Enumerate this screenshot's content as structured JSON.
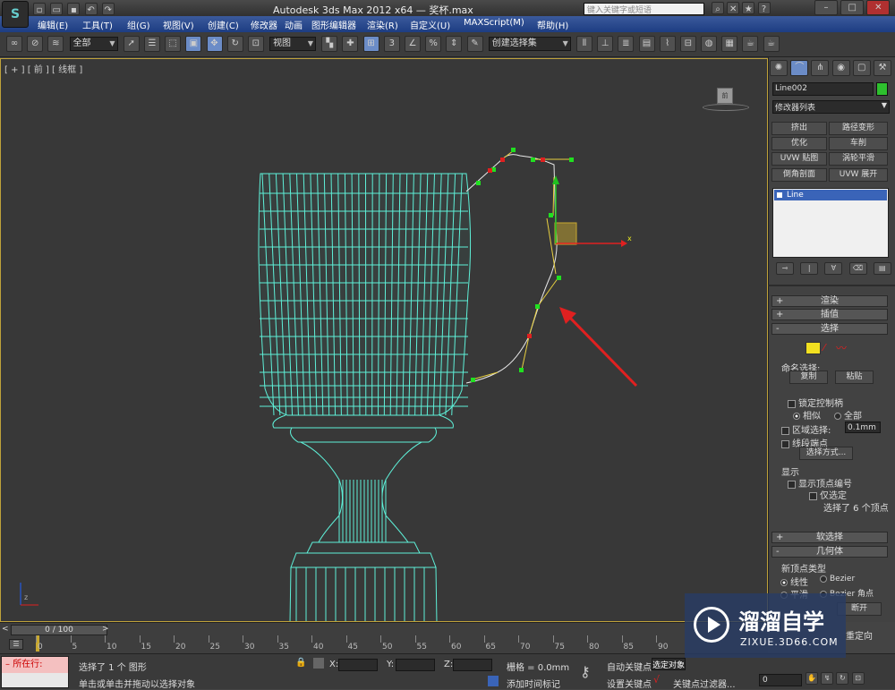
{
  "window": {
    "title": "Autodesk 3ds Max  2012 x64 — 奖杯.max",
    "search_placeholder": "键入关键字或短语"
  },
  "menu": [
    "编辑(E)",
    "工具(T)",
    "组(G)",
    "视图(V)",
    "创建(C)",
    "修改器",
    "动画",
    "图形编辑器",
    "渲染(R)",
    "自定义(U)",
    "MAXScript(M)",
    "帮助(H)"
  ],
  "toolbar": {
    "selection_filter": "全部",
    "ref_coord": "视图",
    "named_selection": "创建选择集"
  },
  "viewport": {
    "label": "[ + ] [ 前 ] [ 线框 ]"
  },
  "panel": {
    "object_name": "Line002",
    "modifier_list": "修改器列表",
    "mod_buttons": [
      "挤出",
      "路径变形",
      "优化",
      "车削",
      "UVW 贴图",
      "涡轮平滑",
      "倒角剖面",
      "UVW 展开"
    ],
    "stack_item": "Line",
    "rollouts": {
      "render": "渲染",
      "interp": "插值",
      "select": "选择",
      "soft": "软选择",
      "geom": "几何体"
    },
    "named_sel": "命名选择:",
    "copy": "复制",
    "paste": "粘贴",
    "lock_handles": "锁定控制柄",
    "similar": "相似",
    "all": "全部",
    "area_sel": "区域选择:",
    "area_val": "0.1mm",
    "seg_end": "线段端点",
    "select_by": "选择方式...",
    "display": "显示",
    "show_vertex_num": "显示顶点编号",
    "only_selected": "仅选定",
    "selected_count": "选择了 6 个顶点",
    "new_vertex_type": "新顶点类型",
    "linear": "线性",
    "bezier": "Bezier",
    "smooth": "平滑",
    "bezier_corner": "Bezier 角点",
    "break": "断开",
    "reorient": "重定向"
  },
  "timeline": {
    "counter": "0 / 100",
    "ticks": [
      "0",
      "5",
      "10",
      "15",
      "20",
      "25",
      "30",
      "35",
      "40",
      "45",
      "50",
      "55",
      "60",
      "65",
      "70",
      "75",
      "80",
      "85",
      "90"
    ]
  },
  "status": {
    "script_label": "所在行:",
    "selected": "选择了 1 个 图形",
    "prompt": "单击或单击并拖动以选择对象",
    "x": "X:",
    "y": "Y:",
    "z": "Z:",
    "grid": "栅格 = 0.0mm",
    "add_time_tag": "添加时间标记",
    "auto_key": "自动关键点",
    "set_key": "设置关键点",
    "selected_obj": "选定对象",
    "key_filters": "关键点过滤器...",
    "frame": "0"
  },
  "watermark": {
    "brand": "溜溜自学",
    "url": "ZIXUE.3D66.COM"
  },
  "colors": {
    "wire": "#5ef0d8",
    "accent": "#bfa23a",
    "arrow": "#e02020"
  }
}
